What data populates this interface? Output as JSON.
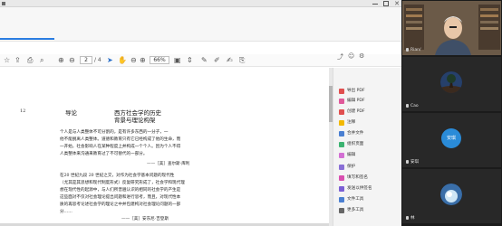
{
  "window": {
    "close_label": "✕"
  },
  "toolbar": {
    "current_page": "2",
    "total_pages": "/ 4",
    "zoom": "66%"
  },
  "document": {
    "page_number": "12",
    "chapter_label": "导论",
    "title_line1": "西方社会学的历史",
    "title_line2": "背景与理论构架",
    "para1": [
      "个人是与人类整体不可分割的，是有许多东西的一分子，一",
      "他不能脱离人类整体。道德和教育只有它已经构成了他的生命，而",
      "一开始，社会影响人在某种程度上并构成一个个人。因为个人不得",
      "人类整体来沟通来教育过了不可替代的一部分。"
    ],
    "sig1": "——［美］查尔斯·库利",
    "para2": [
      "在20 世纪九段 20 世纪之交，对作为社会学基本问题的现代性",
      "（尤其是其思想和现代制度形式）反复研究形成了，社会学和现代理",
      "想在现代性的起源中，与人们所普遍认识的相同的社会学的产生是",
      "这些面对不仅对社会理论提出问题和进行思考，而且，对现代性本",
      "质的再思考论述社会学的理论之中并包建构对社会理论问题的一部",
      "分……"
    ],
    "sig2": "——［美］安东尼·吉登斯"
  },
  "sidepanel": {
    "items": [
      {
        "label": "导出 PDF",
        "color": "#e04f4f",
        "icon": "export-pdf-icon"
      },
      {
        "label": "编辑 PDF",
        "color": "#e05a9a",
        "icon": "edit-pdf-icon"
      },
      {
        "label": "创建 PDF",
        "color": "#e04f4f",
        "icon": "create-pdf-icon"
      },
      {
        "label": "注释",
        "color": "#f2b800",
        "icon": "comment-icon"
      },
      {
        "label": "合并文件",
        "color": "#4a7fd1",
        "icon": "combine-files-icon"
      },
      {
        "label": "组织页面",
        "color": "#3cb371",
        "icon": "organize-pages-icon"
      },
      {
        "label": "编辑",
        "color": "#d36fd3",
        "icon": "redact-icon"
      },
      {
        "label": "保护",
        "color": "#8a6fd6",
        "icon": "protect-icon"
      },
      {
        "label": "填写和签名",
        "color": "#d94fb0",
        "icon": "fill-sign-icon"
      },
      {
        "label": "发送以供签名",
        "color": "#7b5fd4",
        "icon": "send-signature-icon"
      },
      {
        "label": "文件工具",
        "color": "#4a7fd1",
        "icon": "file-tools-icon"
      },
      {
        "label": "更多工具",
        "color": "#666666",
        "icon": "more-tools-icon"
      }
    ]
  },
  "participants": [
    {
      "label": "Rian/",
      "type": "video-person"
    },
    {
      "label": "Cao",
      "type": "wallpaper-tree"
    },
    {
      "label": "安琪",
      "type": "initials",
      "initials": "安琪"
    },
    {
      "label": "林",
      "type": "wallpaper-planet"
    }
  ],
  "colors": {
    "accent": "#2a7de1",
    "video_bg": "#1b1b1b",
    "avatar_blue": "#2a8bd8"
  }
}
